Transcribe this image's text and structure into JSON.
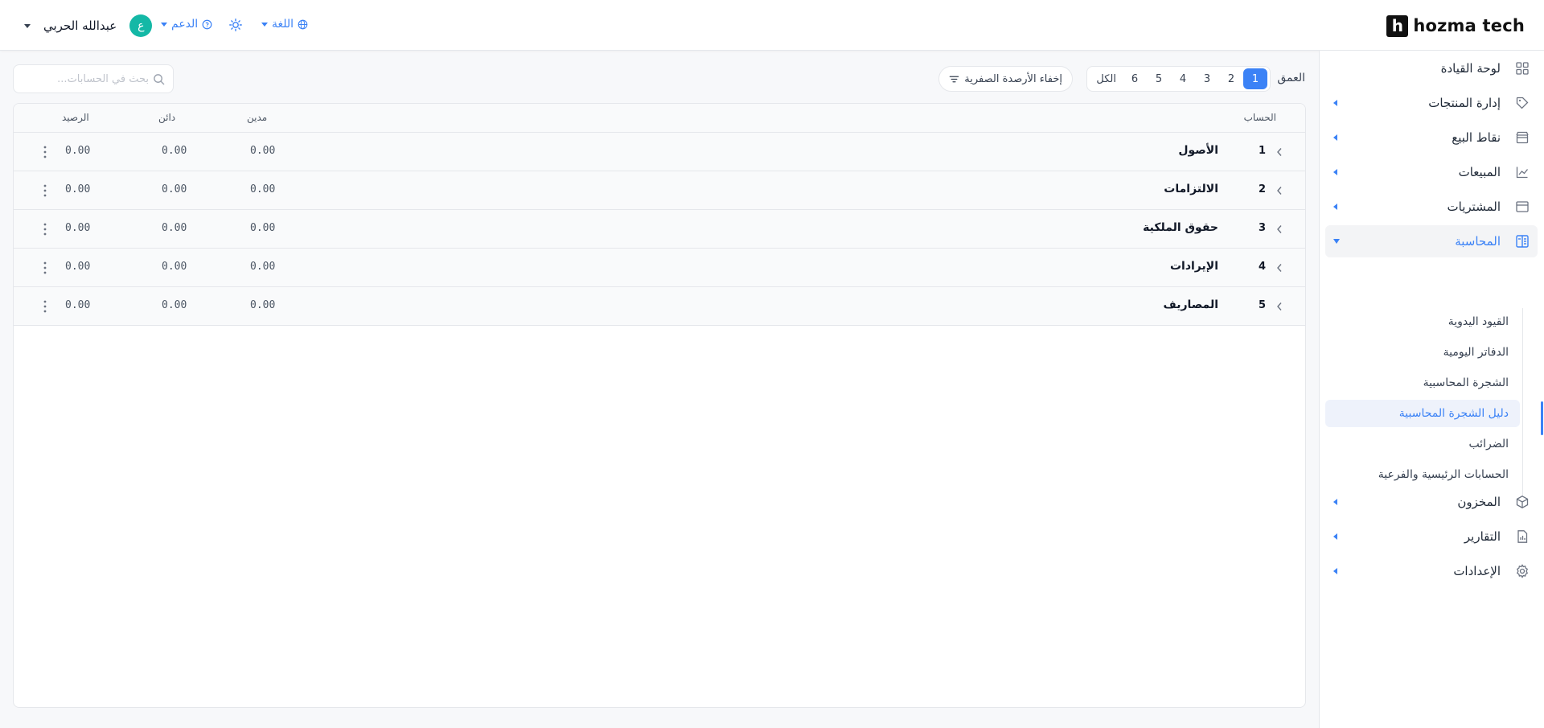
{
  "header": {
    "brand": "hozma tech",
    "brand_mark": "h",
    "user_name": "عبدالله الحربي",
    "avatar_initial": "ع",
    "support_label": "الدعم",
    "language_label": "اللغة"
  },
  "sidebar": {
    "items": [
      {
        "label": "لوحة القيادة",
        "icon": "dashboard-icon"
      },
      {
        "label": "إدارة المنتجات",
        "icon": "tag-icon"
      },
      {
        "label": "نقاط البيع",
        "icon": "store-icon"
      },
      {
        "label": "المبيعات",
        "icon": "chart-line-icon"
      },
      {
        "label": "المشتريات",
        "icon": "wallet-icon"
      },
      {
        "label": "المحاسبة",
        "icon": "accounting-icon"
      },
      {
        "label": "المخزون",
        "icon": "box-icon"
      },
      {
        "label": "التقارير",
        "icon": "report-icon"
      },
      {
        "label": "الإعدادات",
        "icon": "gear-icon"
      }
    ],
    "accounting_sub": [
      {
        "label": "القيود اليدوية"
      },
      {
        "label": "الدفاتر اليومية"
      },
      {
        "label": "الشجرة المحاسبية"
      },
      {
        "label": "دليل الشجرة المحاسبية"
      },
      {
        "label": "الضرائب"
      },
      {
        "label": "الحسابات الرئيسية والفرعية"
      }
    ]
  },
  "toolbar": {
    "depth_label": "العمق",
    "depth_options": [
      "1",
      "2",
      "3",
      "4",
      "5",
      "6",
      "الكل"
    ],
    "depth_selected": "1",
    "hide_zero_label": "إخفاء الأرصدة الصفرية",
    "search_placeholder": "بحث في الحسابات..."
  },
  "table": {
    "columns": {
      "account": "الحساب",
      "debit": "مدين",
      "credit": "دائن",
      "balance": "الرصيد"
    },
    "rows": [
      {
        "code": "1",
        "name": "الأصول",
        "debit": "0.00",
        "credit": "0.00",
        "balance": "0.00"
      },
      {
        "code": "2",
        "name": "الالتزامات",
        "debit": "0.00",
        "credit": "0.00",
        "balance": "0.00"
      },
      {
        "code": "3",
        "name": "حقوق الملكية",
        "debit": "0.00",
        "credit": "0.00",
        "balance": "0.00"
      },
      {
        "code": "4",
        "name": "الإيرادات",
        "debit": "0.00",
        "credit": "0.00",
        "balance": "0.00"
      },
      {
        "code": "5",
        "name": "المصاريف",
        "debit": "0.00",
        "credit": "0.00",
        "balance": "0.00"
      }
    ]
  },
  "colors": {
    "accent": "#3b82f6",
    "avatar": "#14b8a6"
  }
}
